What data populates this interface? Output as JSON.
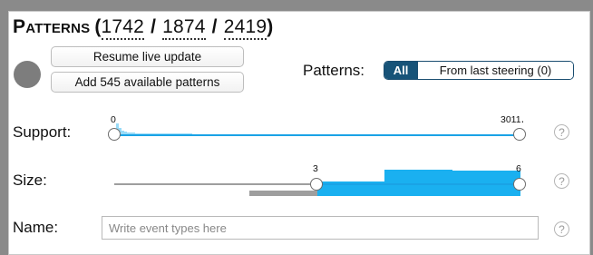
{
  "header": {
    "title": "Patterns",
    "paren_open": "(",
    "paren_close": ")",
    "slash": "/",
    "counts": [
      "1742",
      "1874",
      "2419"
    ]
  },
  "controls": {
    "status_color": "#7d7d7d",
    "resume_label": "Resume live update",
    "add_label": "Add 545 available patterns"
  },
  "patterns_filter": {
    "label": "Patterns:",
    "options": [
      "All",
      "From last steering (0)"
    ],
    "selected": "All",
    "accent_color": "#175378"
  },
  "support": {
    "label": "Support:",
    "min_label": "0",
    "max_label": "3011․",
    "histogram": [
      1.0,
      0.55,
      0.35,
      0.25,
      0.2,
      0.16,
      0.13,
      0.11,
      0.09,
      0.08,
      0.07,
      0.06,
      0.05,
      0.05,
      0.04,
      0.04,
      0.03,
      0.03,
      0.03,
      0.02,
      0.02,
      0.02,
      0.02,
      0.02,
      0.01,
      0.01,
      0.01,
      0.01
    ],
    "help": "?"
  },
  "size": {
    "label": "Size:",
    "min_label": "3",
    "max_label": "6",
    "bars": [
      {
        "level": 0.0,
        "color": "#9e9e9e"
      },
      {
        "level": 0.18,
        "color": "#9e9e9e"
      },
      {
        "level": 0.48,
        "color": "#1ab0f0"
      },
      {
        "level": 0.85,
        "color": "#1ab0f0"
      },
      {
        "level": 0.82,
        "color": "#1ab0f0"
      }
    ],
    "help": "?"
  },
  "name": {
    "label": "Name:",
    "placeholder": "Write event types here",
    "help": "?"
  },
  "colors": {
    "track": "#1aa3e6",
    "histogram_blue": "#1ab0f0",
    "histogram_grey": "#9e9e9e"
  }
}
